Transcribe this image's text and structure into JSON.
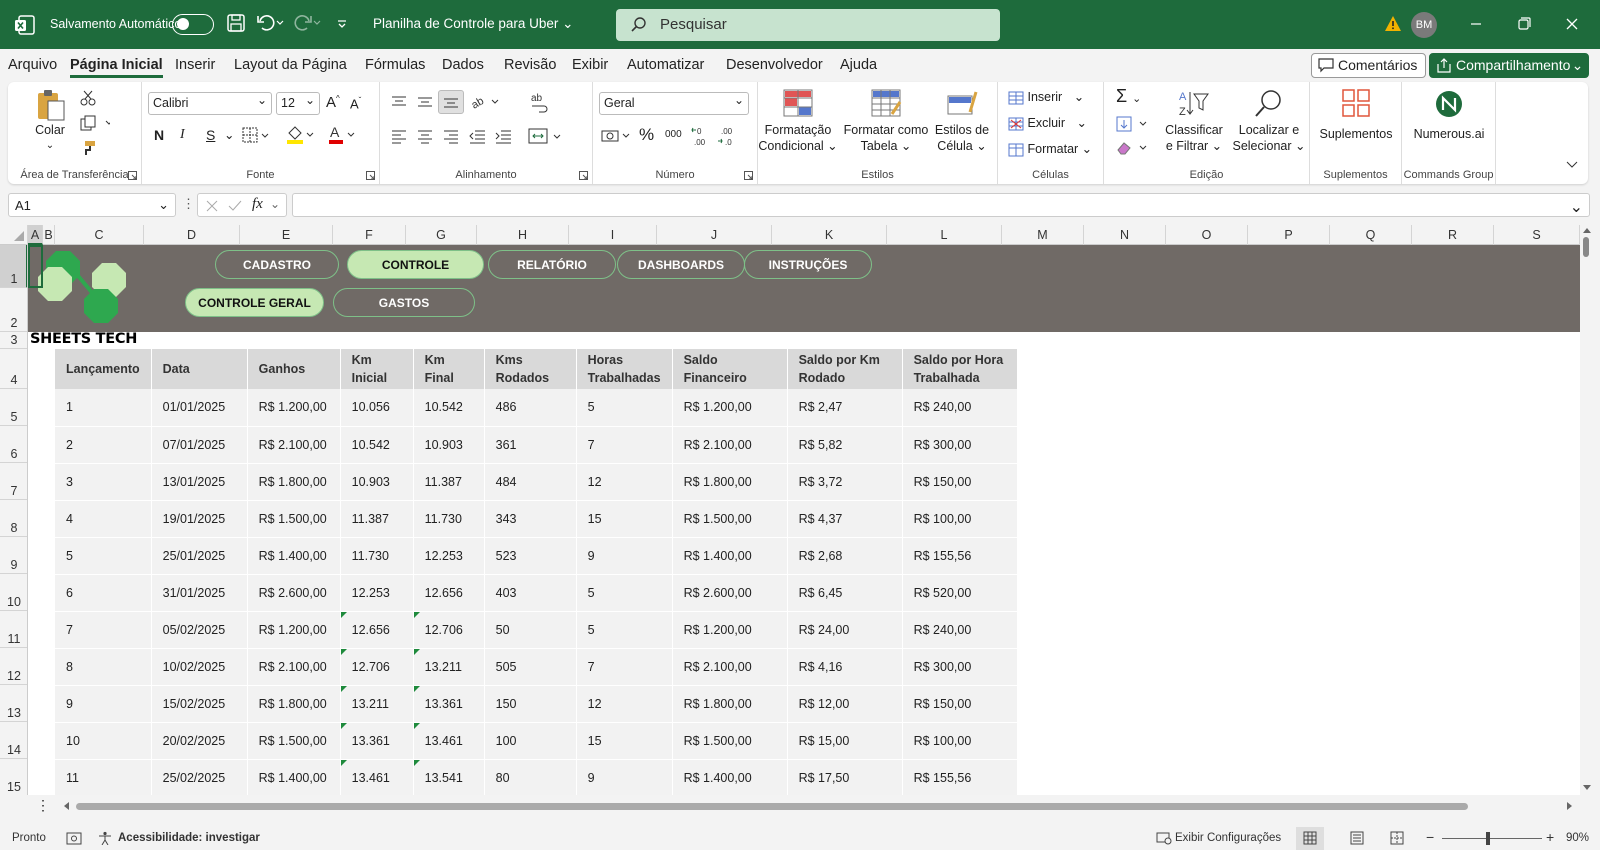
{
  "title_bar": {
    "autosave_label": "Salvamento Automático",
    "document_title": "Planilha de Controle para Uber",
    "search_placeholder": "Pesquisar",
    "avatar_initials": "BM"
  },
  "menu": {
    "tabs": [
      "Arquivo",
      "Página Inicial",
      "Inserir",
      "Layout da Página",
      "Fórmulas",
      "Dados",
      "Revisão",
      "Exibir",
      "Automatizar",
      "Desenvolvedor",
      "Ajuda"
    ],
    "active_tab": "Página Inicial",
    "comments_label": "Comentários",
    "share_label": "Compartilhamento"
  },
  "ribbon": {
    "clipboard": {
      "paste_label": "Colar",
      "group_label": "Área de Transferência"
    },
    "font": {
      "font_name": "Calibri",
      "font_size": "12",
      "bold": "N",
      "italic": "I",
      "underline": "S",
      "group_label": "Fonte"
    },
    "alignment": {
      "group_label": "Alinhamento"
    },
    "number": {
      "format": "Geral",
      "group_label": "Número"
    },
    "styles": {
      "conditional_line1": "Formatação",
      "conditional_line2": "Condicional",
      "table_line1": "Formatar como",
      "table_line2": "Tabela",
      "cell_line1": "Estilos de",
      "cell_line2": "Célula",
      "group_label": "Estilos"
    },
    "cells": {
      "insert": "Inserir",
      "delete": "Excluir",
      "format": "Formatar",
      "group_label": "Células"
    },
    "editing": {
      "sort_line1": "Classificar",
      "sort_line2": "e Filtrar",
      "find_line1": "Localizar e",
      "find_line2": "Selecionar",
      "group_label": "Edição"
    },
    "addins": {
      "label": "Suplementos",
      "group_label": "Suplementos"
    },
    "commands": {
      "label": "Numerous.ai",
      "group_label": "Commands Group"
    }
  },
  "formula_bar": {
    "name_box": "A1",
    "fx": "fx"
  },
  "columns": [
    "A",
    "B",
    "C",
    "D",
    "E",
    "F",
    "G",
    "H",
    "I",
    "J",
    "K",
    "L",
    "M",
    "N",
    "O",
    "P",
    "Q",
    "R",
    "S"
  ],
  "rows": [
    "1",
    "2",
    "3",
    "4",
    "5",
    "6",
    "7",
    "8",
    "9",
    "10",
    "11",
    "12",
    "13",
    "14",
    "15"
  ],
  "sheet": {
    "nav_top": [
      "CADASTRO",
      "CONTROLE",
      "RELATÓRIO",
      "DASHBOARDS",
      "INSTRUÇÕES"
    ],
    "nav_bottom": [
      "CONTROLE GERAL",
      "GASTOS"
    ],
    "brand": "SHEETS TECH",
    "headers": [
      "Lançamento",
      "Data",
      "Ganhos",
      "Km Inicial",
      "Km Final",
      "Kms Rodados",
      "Horas Trabalhadas",
      "Saldo Financeiro",
      "Saldo por Km Rodado",
      "Saldo por Hora Trabalhada"
    ],
    "rows": [
      [
        "1",
        "01/01/2025",
        "R$ 1.200,00",
        "10.056",
        "10.542",
        "486",
        "5",
        "R$ 1.200,00",
        "R$ 2,47",
        "R$ 240,00"
      ],
      [
        "2",
        "07/01/2025",
        "R$ 2.100,00",
        "10.542",
        "10.903",
        "361",
        "7",
        "R$ 2.100,00",
        "R$ 5,82",
        "R$ 300,00"
      ],
      [
        "3",
        "13/01/2025",
        "R$ 1.800,00",
        "10.903",
        "11.387",
        "484",
        "12",
        "R$ 1.800,00",
        "R$ 3,72",
        "R$ 150,00"
      ],
      [
        "4",
        "19/01/2025",
        "R$ 1.500,00",
        "11.387",
        "11.730",
        "343",
        "15",
        "R$ 1.500,00",
        "R$ 4,37",
        "R$ 100,00"
      ],
      [
        "5",
        "25/01/2025",
        "R$ 1.400,00",
        "11.730",
        "12.253",
        "523",
        "9",
        "R$ 1.400,00",
        "R$ 2,68",
        "R$ 155,56"
      ],
      [
        "6",
        "31/01/2025",
        "R$ 2.600,00",
        "12.253",
        "12.656",
        "403",
        "5",
        "R$ 2.600,00",
        "R$ 6,45",
        "R$ 520,00"
      ],
      [
        "7",
        "05/02/2025",
        "R$ 1.200,00",
        "12.656",
        "12.706",
        "50",
        "5",
        "R$ 1.200,00",
        "R$ 24,00",
        "R$ 240,00"
      ],
      [
        "8",
        "10/02/2025",
        "R$ 2.100,00",
        "12.706",
        "13.211",
        "505",
        "7",
        "R$ 2.100,00",
        "R$ 4,16",
        "R$ 300,00"
      ],
      [
        "9",
        "15/02/2025",
        "R$ 1.800,00",
        "13.211",
        "13.361",
        "150",
        "12",
        "R$ 1.800,00",
        "R$ 12,00",
        "R$ 150,00"
      ],
      [
        "10",
        "20/02/2025",
        "R$ 1.500,00",
        "13.361",
        "13.461",
        "100",
        "15",
        "R$ 1.500,00",
        "R$ 15,00",
        "R$ 100,00"
      ],
      [
        "11",
        "25/02/2025",
        "R$ 1.400,00",
        "13.461",
        "13.541",
        "80",
        "9",
        "R$ 1.400,00",
        "R$ 17,50",
        "R$ 155,56"
      ]
    ]
  },
  "status_bar": {
    "ready": "Pronto",
    "accessibility": "Acessibilidade: investigar",
    "display_settings": "Exibir Configurações",
    "zoom": "90%"
  },
  "colors": {
    "excel_green": "#1e6b3c",
    "banner_gray": "#706a66",
    "nav_active": "#c6e8b3"
  }
}
